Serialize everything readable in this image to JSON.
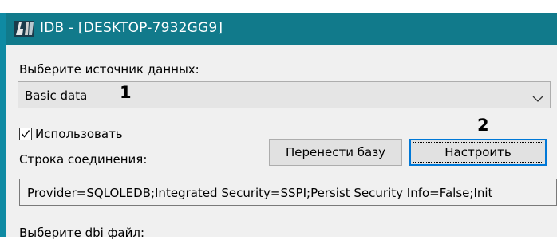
{
  "window": {
    "title": "IDB - [DESKTOP-7932GG9]",
    "icon": "app-icon"
  },
  "source_section": {
    "label": "Выберите источник данных:",
    "selected_value": "Basic data"
  },
  "annotations": {
    "marker_1": "1",
    "marker_2": "2"
  },
  "use_checkbox": {
    "label": "Использовать",
    "checked": true
  },
  "connection": {
    "label": "Строка соединения:",
    "value": "Provider=SQLOLEDB;Integrated Security=SSPI;Persist Security Info=False;Init"
  },
  "buttons": {
    "migrate_label": "Перенести базу",
    "configure_label": "Настроить"
  },
  "dbi_section": {
    "label": "Выберите dbi файл:"
  },
  "colors": {
    "titlebar": "#117a8b",
    "focus_border": "#0078d7",
    "window_bg": "#f0f0f0"
  }
}
